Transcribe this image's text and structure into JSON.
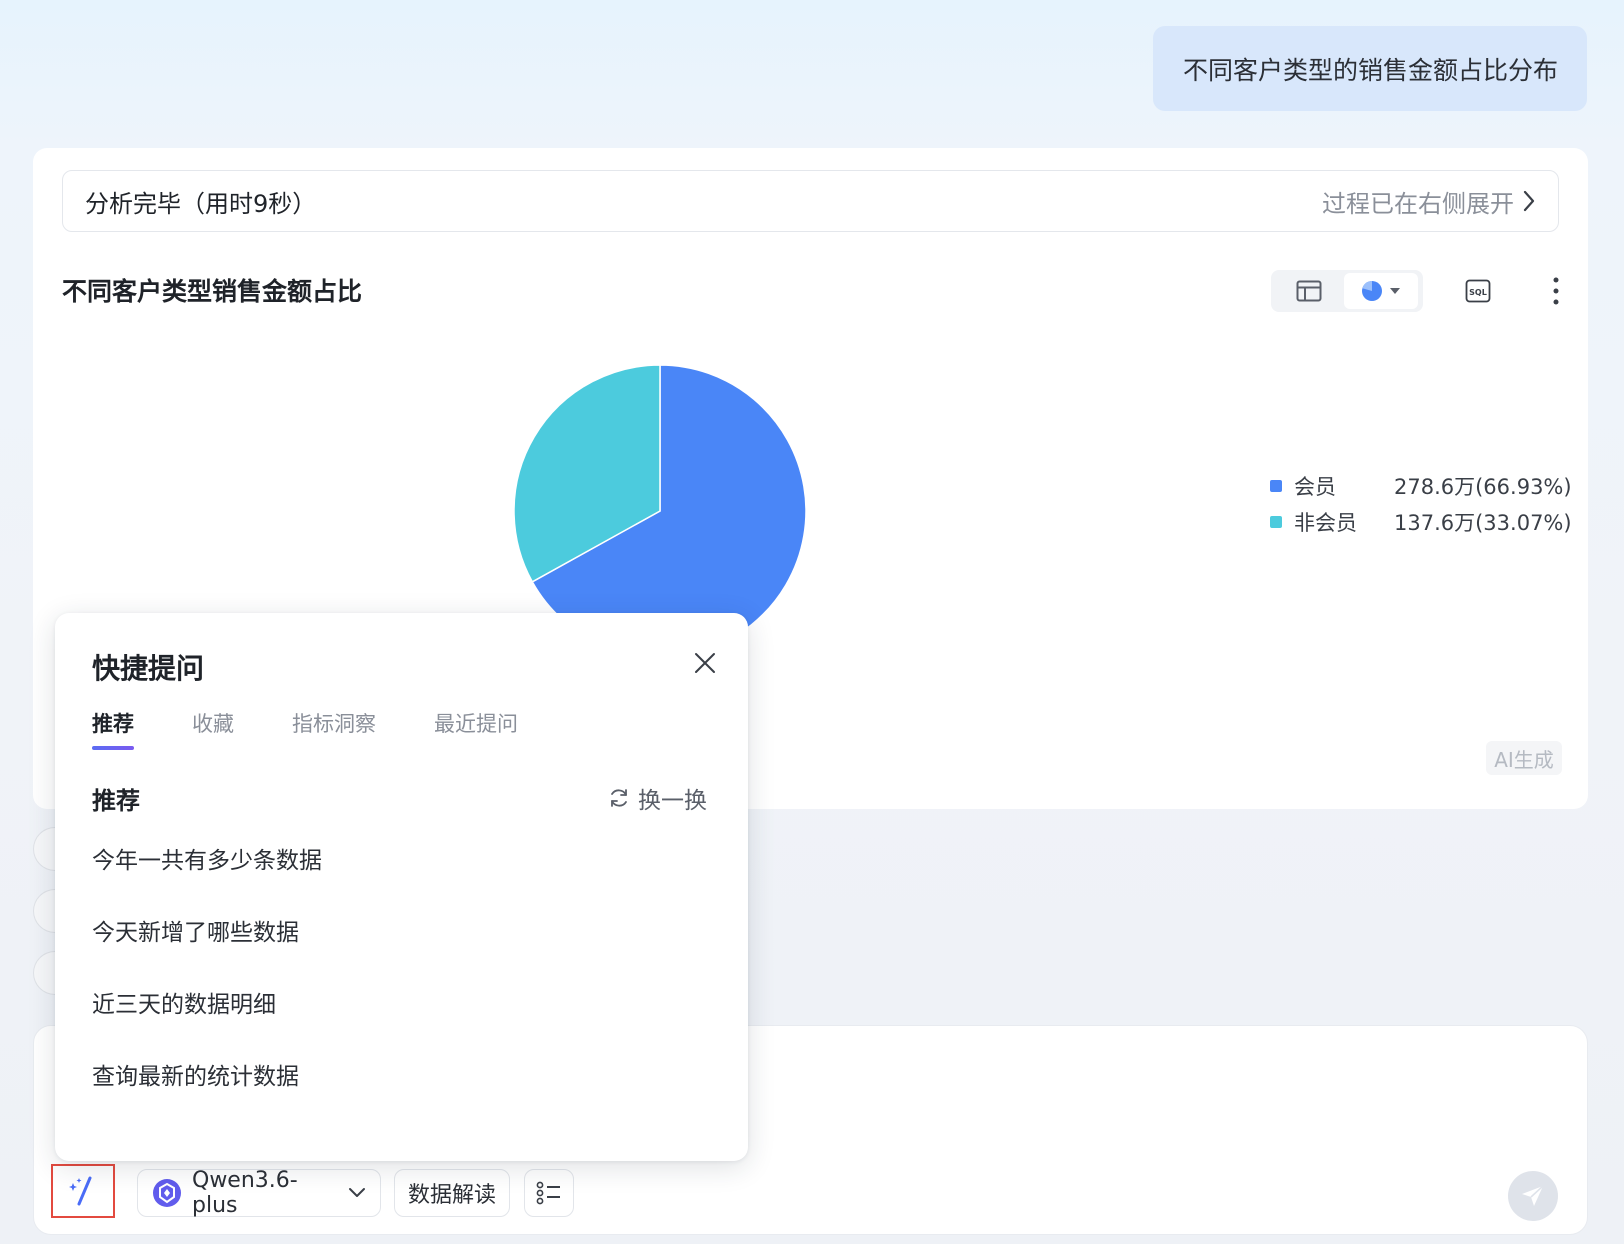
{
  "user_message": "不同客户类型的销售金额占比分布",
  "answer": {
    "status": "分析完毕（用时9秒）",
    "expand_link": "过程已在右侧展开",
    "chart_title": "不同客户类型销售金额占比",
    "ai_badge": "AI生成",
    "toolbar": {
      "table_icon": "table-icon",
      "pie_icon": "pie-chart-icon",
      "sql_icon": "sql-icon",
      "more_icon": "more-vertical-icon"
    }
  },
  "chart_data": {
    "type": "pie",
    "slices": [
      {
        "name": "会员",
        "value": 278.6,
        "label": "278.6万(66.93%)",
        "percent": 66.93,
        "color": "#4a86f7"
      },
      {
        "name": "非会员",
        "value": 137.6,
        "label": "137.6万(33.07%)",
        "percent": 33.07,
        "color": "#4ccbdd"
      }
    ],
    "legend_position": "right"
  },
  "popup": {
    "title": "快捷提问",
    "tabs": [
      {
        "label": "推荐",
        "active": true
      },
      {
        "label": "收藏",
        "active": false
      },
      {
        "label": "指标洞察",
        "active": false
      },
      {
        "label": "最近提问",
        "active": false
      }
    ],
    "section_title": "推荐",
    "refresh_label": "换一换",
    "questions": [
      "今年一共有多少条数据",
      "今天新增了哪些数据",
      "近三天的数据明细",
      "查询最新的统计数据"
    ]
  },
  "input": {
    "model": "Qwen3.6-plus",
    "interpret_label": "数据解读"
  },
  "colors": {
    "accent": "#4a86f7",
    "highlight_border": "#e34a3f"
  }
}
